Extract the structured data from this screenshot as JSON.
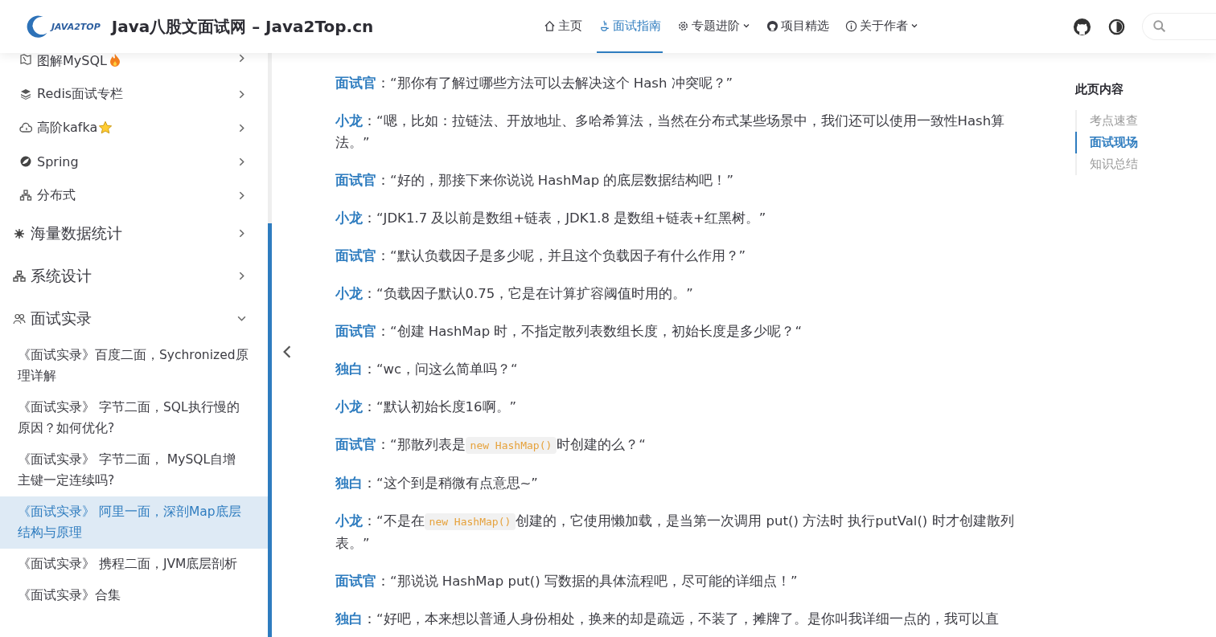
{
  "header": {
    "site_title": "Java八股文面试网 – Java2Top.cn",
    "logo_text": "JAVA2TOP",
    "nav": [
      {
        "label": "主页",
        "selected": false,
        "dropdown": false
      },
      {
        "label": "面试指南",
        "selected": true,
        "dropdown": false
      },
      {
        "label": "专题进阶",
        "selected": false,
        "dropdown": true
      },
      {
        "label": "项目精选",
        "selected": false,
        "dropdown": false
      },
      {
        "label": "关于作者",
        "selected": false,
        "dropdown": true
      }
    ]
  },
  "sidebar": {
    "items": [
      {
        "label": "图解MySQL",
        "expanded": false
      },
      {
        "label": "Redis面试专栏",
        "expanded": false
      },
      {
        "label": "高阶kafka",
        "expanded": false
      },
      {
        "label": "Spring",
        "expanded": false
      },
      {
        "label": "分布式",
        "expanded": false
      },
      {
        "label": "海量数据统计",
        "expanded": false
      },
      {
        "label": "系统设计",
        "expanded": false
      },
      {
        "label": "面试实录",
        "expanded": true,
        "children": [
          {
            "label": "《面试实录》百度二面，Sychronized原理详解",
            "selected": false
          },
          {
            "label": "《面试实录》 字节二面，SQL执行慢的原因？如何优化?",
            "selected": false
          },
          {
            "label": "《面试实录》 字节二面， MySQL自增主键一定连续吗?",
            "selected": false
          },
          {
            "label": "《面试实录》 阿里一面，深剖Map底层结构与原理",
            "selected": true
          },
          {
            "label": "《面试实录》 携程二面，JVM底层剖析",
            "selected": false
          },
          {
            "label": "《面试实录》合集",
            "selected": false
          }
        ]
      }
    ]
  },
  "article": {
    "paragraphs": [
      {
        "speaker": "面试官",
        "parts": [
          {
            "kind": "text",
            "text": "：“那你有了解过哪些方法可以去解决这个 Hash 冲突呢？”"
          }
        ]
      },
      {
        "speaker": "小龙",
        "parts": [
          {
            "kind": "text",
            "text": "：“嗯，比如：拉链法、开放地址、多哈希算法，当然在分布式某些场景中，我们还可以使用一致性Hash算法。”"
          }
        ]
      },
      {
        "speaker": "面试官",
        "parts": [
          {
            "kind": "text",
            "text": "：“好的，那接下来你说说 HashMap 的底层数据结构吧！”"
          }
        ]
      },
      {
        "speaker": "小龙",
        "parts": [
          {
            "kind": "text",
            "text": "：“JDK1.7 及以前是数组+链表，JDK1.8 是数组+链表+红黑树。”"
          }
        ]
      },
      {
        "speaker": "面试官",
        "parts": [
          {
            "kind": "text",
            "text": "：“默认负载因子是多少呢，并且这个负载因子有什么作用？”"
          }
        ]
      },
      {
        "speaker": "小龙",
        "parts": [
          {
            "kind": "text",
            "text": "：“负载因子默认0.75，它是在计算扩容阈值时用的。”"
          }
        ]
      },
      {
        "speaker": "面试官",
        "parts": [
          {
            "kind": "text",
            "text": "：“创建 HashMap 时，不指定散列表数组长度，初始长度是多少呢？“"
          }
        ]
      },
      {
        "speaker": "独白",
        "parts": [
          {
            "kind": "text",
            "text": "：“wc，问这么简单吗？“"
          }
        ]
      },
      {
        "speaker": "小龙",
        "parts": [
          {
            "kind": "text",
            "text": "：“默认初始长度16啊。”"
          }
        ]
      },
      {
        "speaker": "面试官",
        "parts": [
          {
            "kind": "text",
            "text": "：“那散列表是"
          },
          {
            "kind": "code",
            "text": "new HashMap()"
          },
          {
            "kind": "text",
            "text": "时创建的么？“"
          }
        ]
      },
      {
        "speaker": "独白",
        "parts": [
          {
            "kind": "text",
            "text": "：“这个到是稍微有点意思~”"
          }
        ]
      },
      {
        "speaker": "小龙",
        "parts": [
          {
            "kind": "text",
            "text": "：“不是在"
          },
          {
            "kind": "code",
            "text": "new HashMap()"
          },
          {
            "kind": "text",
            "text": "创建的，它使用懒加载，是当第一次调用 put() 方法时 执行putVal() 时才创建散列表。”"
          }
        ]
      },
      {
        "speaker": "面试官",
        "parts": [
          {
            "kind": "text",
            "text": "：“那说说 HashMap put() 写数据的具体流程吧，尽可能的详细点！”"
          }
        ]
      },
      {
        "speaker": "独白",
        "parts": [
          {
            "kind": "text",
            "text": "：“好吧，本来想以普通人身份相处，换来的却是疏远，不装了，摊牌了。是你叫我详细一点的，我可以直"
          }
        ]
      }
    ]
  },
  "toc": {
    "title": "此页内容",
    "items": [
      {
        "label": "考点速查",
        "selected": false
      },
      {
        "label": "面试现场",
        "selected": true
      },
      {
        "label": "知识总结",
        "selected": false
      }
    ]
  }
}
